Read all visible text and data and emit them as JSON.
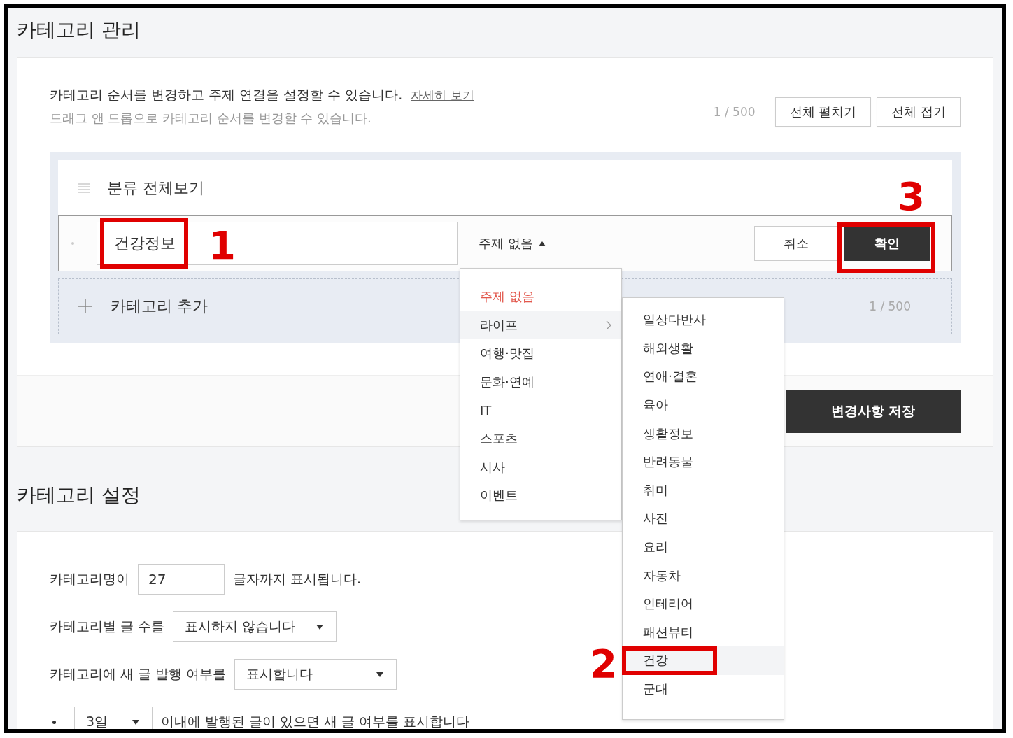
{
  "page_title": "카테고리 관리",
  "management": {
    "description": "카테고리 순서를 변경하고 주제 연결을 설정할 수 있습니다.",
    "help_link": "자세히 보기",
    "hint": "드래그 앤 드롭으로 카테고리 순서를 변경할 수 있습니다.",
    "count": "1 / 500",
    "buttons": [
      "전체 펼치기",
      "전체 접기"
    ],
    "root_item": "분류 전체보기",
    "editing_item": {
      "name": "건강정보",
      "topic": "주제 없음",
      "expanded": true,
      "cancel": "취소",
      "confirm": "확인"
    },
    "add_item": {
      "label": "카테고리 추가",
      "count": "1 / 500"
    },
    "save_button": "변경사항 저장"
  },
  "topic_menu": [
    {
      "label": "주제 없음",
      "selected": true,
      "highlighted": false,
      "has_submenu": false
    },
    {
      "label": "라이프",
      "selected": false,
      "highlighted": true,
      "has_submenu": true
    },
    {
      "label": "여행·맛집",
      "selected": false,
      "highlighted": false,
      "has_submenu": false
    },
    {
      "label": "문화·연예",
      "selected": false,
      "highlighted": false,
      "has_submenu": false
    },
    {
      "label": "IT",
      "selected": false,
      "highlighted": false,
      "has_submenu": false
    },
    {
      "label": "스포츠",
      "selected": false,
      "highlighted": false,
      "has_submenu": false
    },
    {
      "label": "시사",
      "selected": false,
      "highlighted": false,
      "has_submenu": false
    },
    {
      "label": "이벤트",
      "selected": false,
      "highlighted": false,
      "has_submenu": false
    }
  ],
  "subtopic_menu": [
    {
      "label": "일상다반사",
      "highlighted": false
    },
    {
      "label": "해외생활",
      "highlighted": false
    },
    {
      "label": "연애·결혼",
      "highlighted": false
    },
    {
      "label": "육아",
      "highlighted": false
    },
    {
      "label": "생활정보",
      "highlighted": false
    },
    {
      "label": "반려동물",
      "highlighted": false
    },
    {
      "label": "취미",
      "highlighted": false
    },
    {
      "label": "사진",
      "highlighted": false
    },
    {
      "label": "요리",
      "highlighted": false
    },
    {
      "label": "자동차",
      "highlighted": false
    },
    {
      "label": "인테리어",
      "highlighted": false
    },
    {
      "label": "패션뷰티",
      "highlighted": false
    },
    {
      "label": "건강",
      "highlighted": true
    },
    {
      "label": "군대",
      "highlighted": false
    }
  ],
  "settings": {
    "title": "카테고리 설정",
    "rows": [
      {
        "kind": "input",
        "label": "카테고리명이",
        "value": "27",
        "suffix": "글자까지 표시됩니다."
      },
      {
        "kind": "select",
        "label": "카테고리별 글 수를",
        "value": "표시하지 않습니다"
      },
      {
        "kind": "select",
        "label": "카테고리에 새 글 발행 여부를",
        "value": "표시합니다"
      },
      {
        "kind": "bullet_select",
        "value": "3일",
        "suffix": "이내에 발행된 글이 있으면 새 글 여부를 표시합니다"
      }
    ]
  },
  "annotations": [
    {
      "label": "1"
    },
    {
      "label": "2"
    },
    {
      "label": "3"
    }
  ]
}
